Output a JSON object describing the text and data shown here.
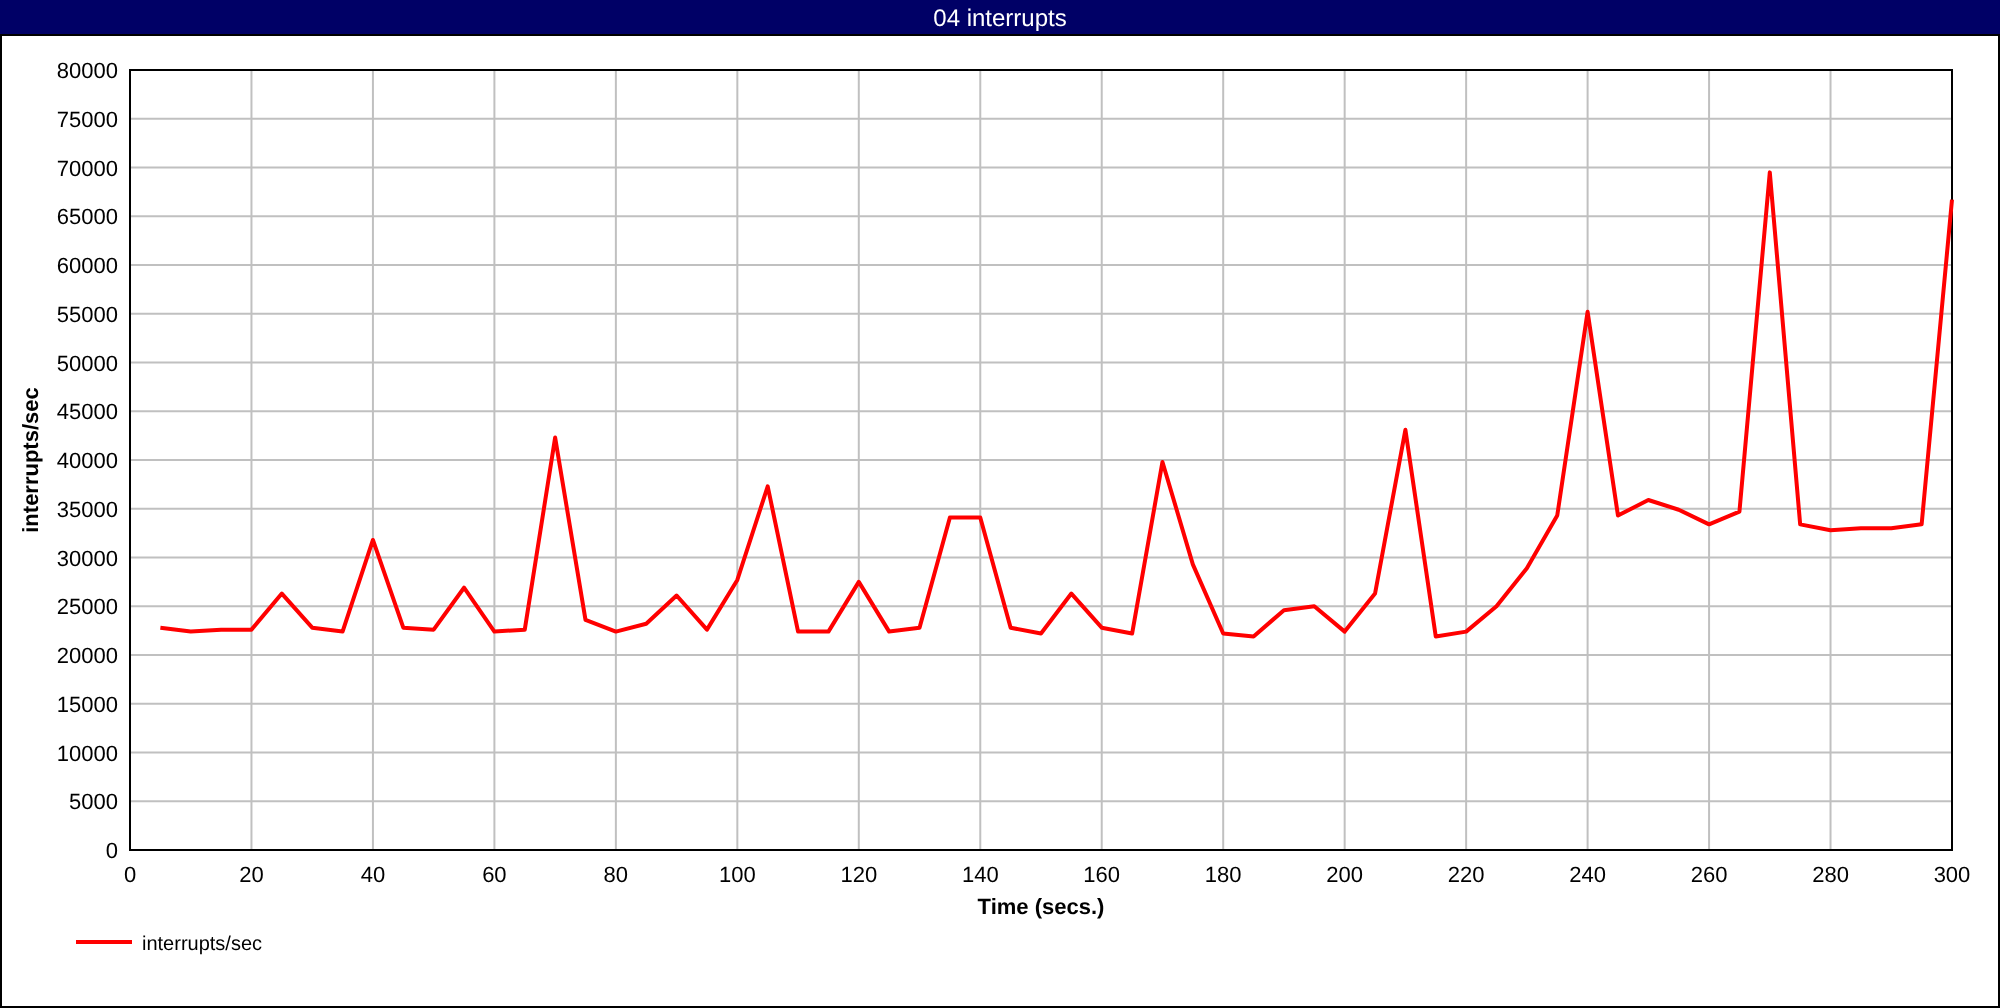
{
  "window": {
    "title": "04 interrupts"
  },
  "chart": {
    "chart_data": {
      "type": "line",
      "grid": true,
      "xlabel": "Time (secs.)",
      "ylabel": "interrupts/sec",
      "xlim": [
        0,
        300
      ],
      "ylim": [
        0,
        80000
      ],
      "xticks": [
        0,
        20,
        40,
        60,
        80,
        100,
        120,
        140,
        160,
        180,
        200,
        220,
        240,
        260,
        280,
        300
      ],
      "yticks": [
        0,
        5000,
        10000,
        15000,
        20000,
        25000,
        30000,
        35000,
        40000,
        45000,
        50000,
        55000,
        60000,
        65000,
        70000,
        75000,
        80000
      ],
      "x": [
        5,
        10,
        15,
        20,
        25,
        30,
        35,
        40,
        45,
        50,
        55,
        60,
        65,
        70,
        75,
        80,
        85,
        90,
        95,
        100,
        105,
        110,
        115,
        120,
        125,
        130,
        135,
        140,
        145,
        150,
        155,
        160,
        165,
        170,
        175,
        180,
        185,
        190,
        195,
        200,
        205,
        210,
        215,
        220,
        225,
        230,
        235,
        240,
        245,
        250,
        255,
        260,
        265,
        270,
        275,
        280,
        285,
        290,
        295,
        300
      ],
      "series": [
        {
          "name": "interrupts/sec",
          "color": "#ff0000",
          "values": [
            22800,
            22400,
            22600,
            22600,
            26300,
            22800,
            22400,
            31800,
            22800,
            22600,
            26900,
            22400,
            22600,
            42300,
            23600,
            22400,
            23200,
            26100,
            22600,
            27700,
            37300,
            22400,
            22400,
            27500,
            22400,
            22800,
            34100,
            34100,
            22800,
            22200,
            26300,
            22800,
            22200,
            39800,
            29300,
            22200,
            21900,
            24600,
            25000,
            22400,
            26300,
            43100,
            21900,
            22400,
            25000,
            28900,
            34300,
            55200,
            34300,
            35900,
            34900,
            33400,
            34700,
            69500,
            33400,
            32800,
            33000,
            33000,
            33400,
            66700
          ]
        }
      ]
    }
  }
}
